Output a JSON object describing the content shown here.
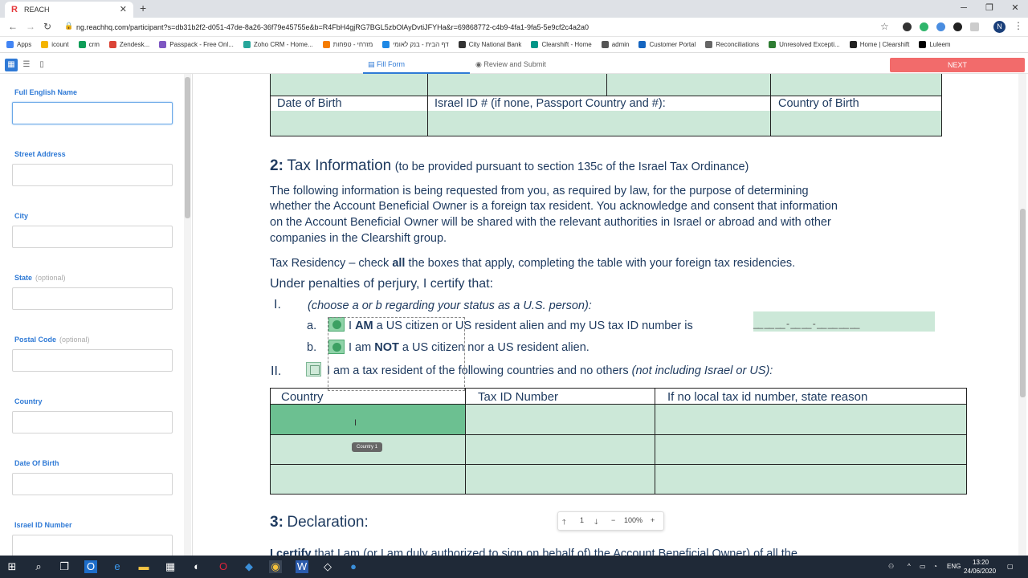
{
  "browser": {
    "tab_title": "REACH",
    "tab_favicon": "R",
    "url": "ng.reachhq.com/participant?s=db31b2f2-d051-47de-8a26-36f79e45755e&b=R4FbH4gjRG7BGL5zbOlAyDvtiJFYHa&r=69868772-c4b9-4fa1-9fa5-5e9cf2c4a2a0",
    "bookmarks": [
      "Apps",
      "icount",
      "crm",
      "Zendesk...",
      "Passpack - Free Onl...",
      "Zoho CRM - Home...",
      "מזרחי - טפחות",
      "דף הבית - בנק לאומי",
      "City National Bank",
      "Clearshift - Home",
      "admin",
      "Customer Portal",
      "Reconciliations",
      "Unresolved Excepti...",
      "Home | Clearshift",
      "Luleem"
    ],
    "avatar_initial": "N"
  },
  "toolbar": {
    "tab_fill": "Fill Form",
    "tab_review": "Review and Submit",
    "next_label": "NEXT"
  },
  "sidebar": {
    "fields": [
      {
        "label": "Full English Name",
        "optional": ""
      },
      {
        "label": "Street Address",
        "optional": ""
      },
      {
        "label": "City",
        "optional": ""
      },
      {
        "label": "State",
        "optional": "(optional)"
      },
      {
        "label": "Postal Code",
        "optional": "(optional)"
      },
      {
        "label": "Country",
        "optional": ""
      },
      {
        "label": "Date Of Birth",
        "optional": ""
      },
      {
        "label": "Israel ID Number",
        "optional": ""
      }
    ]
  },
  "doc": {
    "top_table": {
      "dob": "Date of Birth",
      "israel_id": "Israel ID # (if none, Passport Country and #):",
      "country_birth": "Country of Birth"
    },
    "s2_num": "2:",
    "s2_title": "Tax Information",
    "s2_sub": "(to be provided pursuant to section 135c of the Israel Tax Ordinance)",
    "para": [
      "The following information is being requested from you, as required by law, for the purpose of determining",
      "whether the Account Beneficial Owner is a foreign tax resident. You acknowledge and consent that information",
      "on the Account Beneficial Owner will be shared with the relevant authorities in Israel or abroad and with other",
      "companies in the Clearshift group."
    ],
    "residency_a": "Tax Residency – check",
    "residency_bold": "all",
    "residency_b": "the boxes that apply, completing the table with your foreign tax residencies.",
    "perjury": "Under penalties of perjury, I certify that:",
    "i_num": "I.",
    "i_text": "(choose a or b regarding your status as a U.S. person):",
    "a_num": "a.",
    "a_pre": "I",
    "a_bold": "AM",
    "a_post": "a US citizen or US resident alien and my US tax ID number is",
    "a_mask": "__ __ __ - __ __ - __ __ __ __",
    "b_num": "b.",
    "b_pre": "I am",
    "b_bold": "NOT",
    "b_post": "a US citizen nor a US resident alien.",
    "ii_num": "II.",
    "ii_text": "I am a tax resident of the following countries and no others",
    "ii_ital": "(not including Israel or US):",
    "table_headers": [
      "Country",
      "Tax ID Number",
      "If no local tax id number, state reason"
    ],
    "tooltip": "Country 1",
    "s3_num": "3:",
    "s3_title": "Declaration:",
    "s3_line_bold": "I certify",
    "s3_line": "that I am (or I am duly authorized to sign on behalf of) the Account Beneficial Owner) of all the"
  },
  "zoom": {
    "page": "1",
    "level": "100%"
  },
  "taskbar": {
    "lang": "ENG",
    "time": "13:20",
    "date": "24/06/2020"
  },
  "colors": {
    "accent": "#2f7ad6",
    "next": "#f26b6b",
    "field_green": "#cce8d8",
    "active_green": "#6cc091"
  }
}
